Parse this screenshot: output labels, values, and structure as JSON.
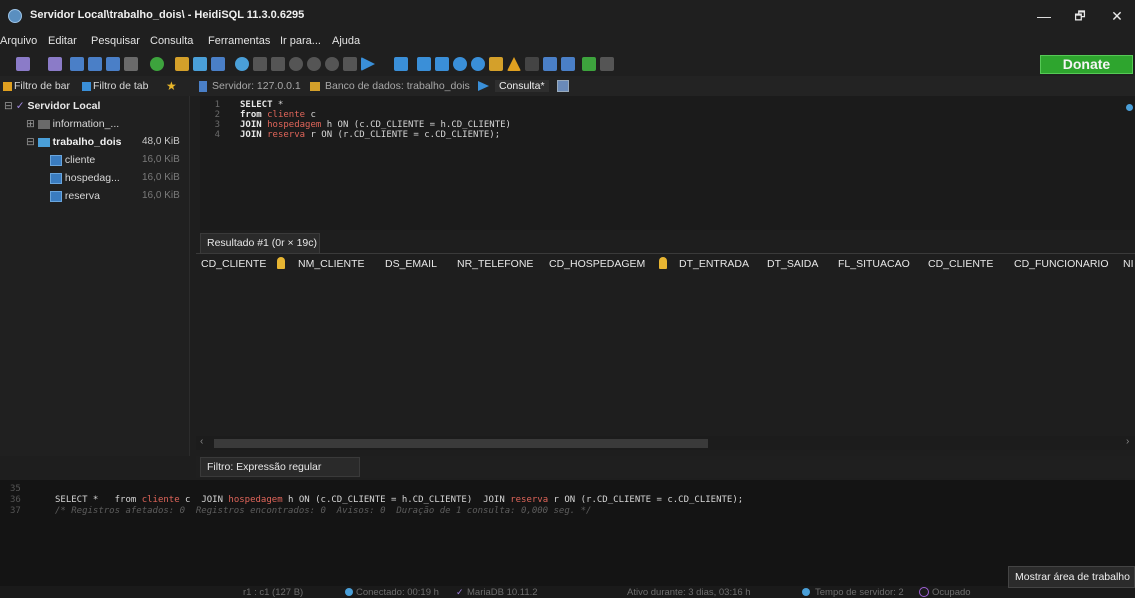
{
  "window": {
    "title": "Servidor Local\\trabalho_dois\\ - HeidiSQL 11.3.0.6295",
    "minimize": "—",
    "maximize": "🗗",
    "close": "✕"
  },
  "menu": [
    "Arquivo",
    "Editar",
    "Pesquisar",
    "Consulta",
    "Ferramentas",
    "Ir para...",
    "Ajuda"
  ],
  "toolbar": {
    "donate_label": "Donate"
  },
  "filters": {
    "db_filter": "Filtro de bar",
    "table_filter": "Filtro de tab"
  },
  "tabs": {
    "server": "Servidor: 127.0.0.1",
    "database": "Banco de dados: trabalho_dois",
    "query": "Consulta*"
  },
  "tree": {
    "root": "Servidor Local",
    "items": [
      {
        "label": "information_...",
        "size": ""
      },
      {
        "label": "trabalho_dois",
        "size": "48,0 KiB"
      },
      {
        "label": "cliente",
        "size": "16,0 KiB"
      },
      {
        "label": "hospedag...",
        "size": "16,0 KiB"
      },
      {
        "label": "reserva",
        "size": "16,0 KiB"
      }
    ]
  },
  "editor": {
    "line_numbers": [
      "1",
      "2",
      "3",
      "4"
    ],
    "lines": [
      {
        "kw": "SELECT",
        "rest": " *"
      },
      {
        "kw": "from",
        "table": "cliente",
        "rest": " c"
      },
      {
        "kw": "JOIN",
        "table": "hospedagem",
        "rest": " h ON (c.CD_CLIENTE = h.CD_CLIENTE)"
      },
      {
        "kw": "JOIN",
        "table": "reserva",
        "rest": " r ON (r.CD_CLIENTE = c.CD_CLIENTE);"
      }
    ]
  },
  "results": {
    "tab_label": "Resultado #1 (0r × 19c)",
    "columns": [
      "CD_CLIENTE",
      "NM_CLIENTE",
      "DS_EMAIL",
      "NR_TELEFONE",
      "CD_HOSPEDAGEM",
      "DT_ENTRADA",
      "DT_SAIDA",
      "FL_SITUACAO",
      "CD_CLIENTE",
      "CD_FUNCIONARIO",
      "NI"
    ]
  },
  "filter": {
    "label": "Filtro:",
    "placeholder": "Expressão regular"
  },
  "log": {
    "line_numbers": [
      "35",
      "36",
      "37"
    ],
    "query_parts": {
      "p1": "SELECT *   from ",
      "t1": "cliente",
      "p2": " c  JOIN ",
      "t2": "hospedagem",
      "p3": " h ON (c.CD_CLIENTE = h.CD_CLIENTE)  JOIN ",
      "t3": "reserva",
      "p4": " r ON (r.CD_CLIENTE = c.CD_CLIENTE);"
    },
    "comment": "/* Registros afetados: 0  Registros encontrados: 0  Avisos: 0  Duração de 1 consulta: 0,000 seg. */"
  },
  "status": {
    "position": "r1 : c1 (127 B)",
    "connected": "Conectado: 00:19 h",
    "server": "MariaDB 10.11.2",
    "uptime": "Ativo durante: 3 dias, 03:16 h",
    "server_time": "Tempo de servidor: 2",
    "busy": "Ocupado"
  },
  "tooltip": "Mostrar área de trabalho",
  "colors": {
    "accent": "#2ea52e",
    "keyword_table": "#e0655a",
    "background": "#1e1e1e"
  }
}
